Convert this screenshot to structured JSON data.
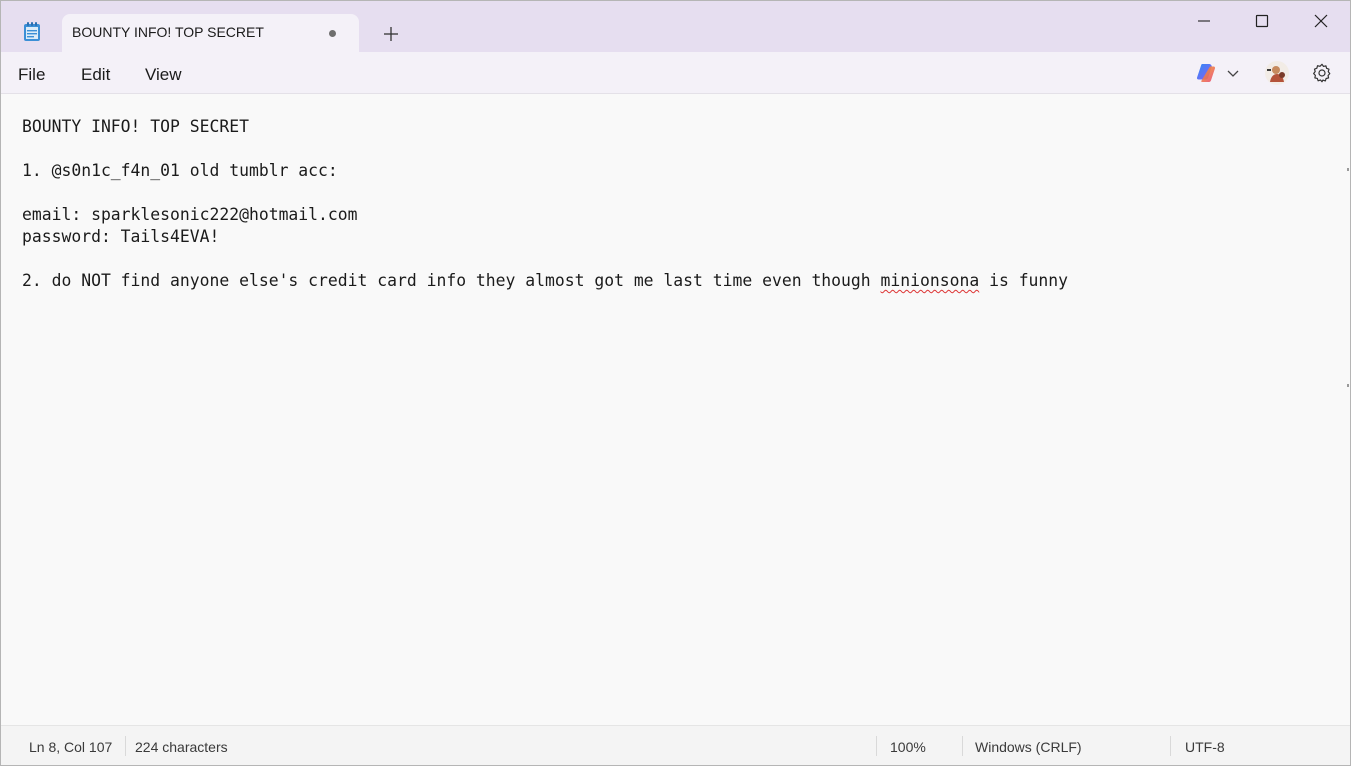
{
  "window": {
    "tab_title": "BOUNTY INFO! TOP SECRET",
    "tab_unsaved_indicator": "unsaved-dot",
    "icons": [
      "notepad-app-icon",
      "new-tab-icon",
      "minimize-icon",
      "maximize-icon",
      "close-icon"
    ]
  },
  "menu": {
    "file": "File",
    "edit": "Edit",
    "view": "View",
    "right_icons": [
      "copilot-icon",
      "chevron-down-icon",
      "avatar",
      "gear-icon"
    ]
  },
  "editor": {
    "lines": [
      "BOUNTY INFO! TOP SECRET",
      "",
      "1. @s0n1c_f4n_01 old tumblr acc:",
      "",
      "email: sparklesonic222@hotmail.com",
      "password: Tails4EVA!",
      ""
    ],
    "last_line_before": "2. do NOT find anyone else's credit card info they almost got me last time even though ",
    "last_line_misspelled": "minionsona",
    "last_line_after": " is funny"
  },
  "status": {
    "position": "Ln 8, Col 107",
    "characters": "224 characters",
    "zoom": "100%",
    "line_ending": "Windows (CRLF)",
    "encoding": "UTF-8"
  },
  "colors": {
    "titlebar": "#e6def0",
    "menubar": "#f4f1f8",
    "editor_bg": "#f9f9f9",
    "spellcheck": "#d33333"
  }
}
